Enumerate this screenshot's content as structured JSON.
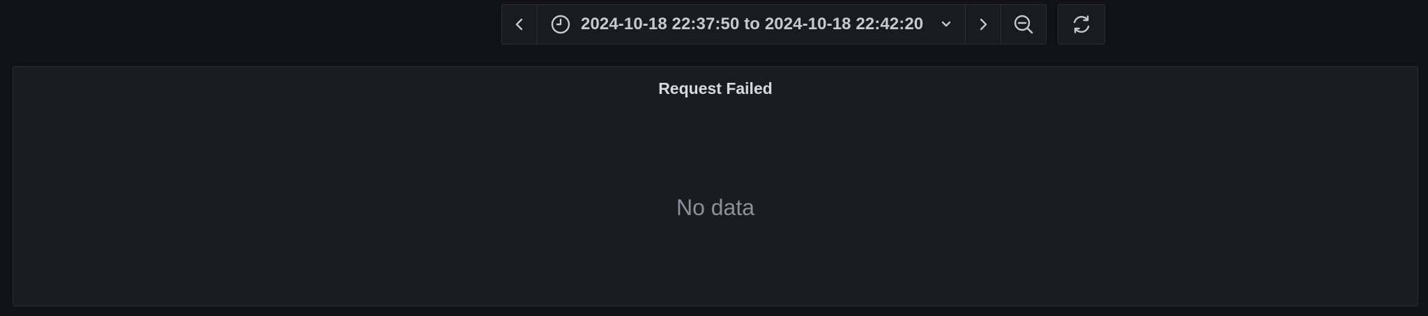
{
  "time_range": {
    "from": "2024-10-18 22:37:50",
    "separator": "to",
    "to": "2024-10-18 22:42:20"
  },
  "icons": {
    "back": "chevron-left-icon",
    "clock": "clock-icon",
    "dropdown": "chevron-down-icon",
    "forward": "chevron-right-icon",
    "zoom_out": "zoom-out-icon",
    "refresh": "refresh-icon"
  },
  "panel": {
    "title": "Request Failed",
    "empty_message": "No data"
  },
  "colors": {
    "background": "#111217",
    "panel": "#1b1c21",
    "text": "#c7c9d1",
    "muted": "#8e9099"
  }
}
